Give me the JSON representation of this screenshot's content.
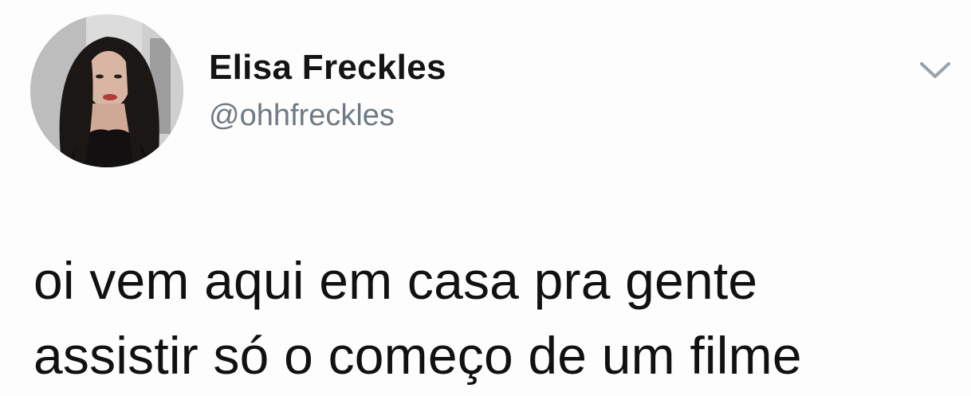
{
  "tweet": {
    "display_name": "Elisa Freckles",
    "handle": "@ohhfreckles",
    "text_lines": [
      "oi vem aqui em casa pra gente",
      "assistir só o começo de um filme"
    ]
  },
  "icons": {
    "menu": "chevron-down-icon",
    "avatar": "profile-photo"
  },
  "colors": {
    "name": "#141414",
    "handle": "#6f7a84",
    "text": "#111111",
    "caret": "#9aa3ab"
  }
}
